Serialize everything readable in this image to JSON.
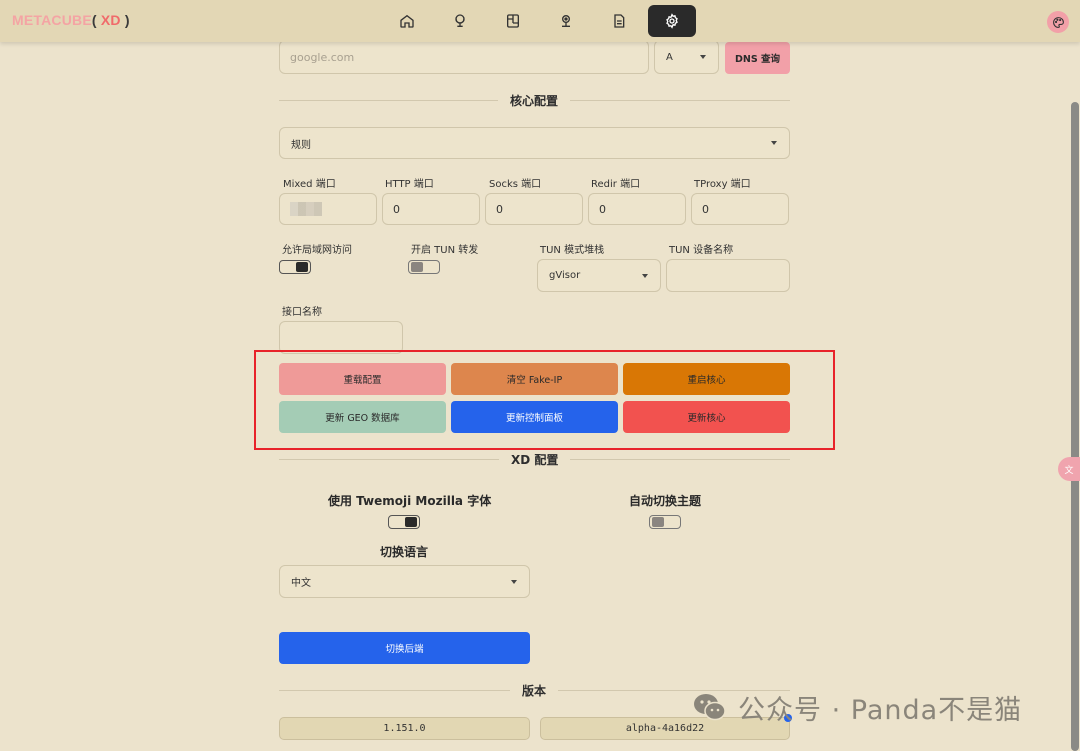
{
  "brand": {
    "part1": "METACUBE",
    "paren_open": "(",
    "part2": " XD ",
    "paren_close": ")"
  },
  "nav": {
    "icons": [
      "home-icon",
      "globe-icon",
      "connections-icon",
      "map-pin-icon",
      "document-icon",
      "gear-icon"
    ],
    "active": "gear-icon"
  },
  "dns": {
    "placeholder": "google.com",
    "type_value": "A",
    "query_button": "DNS 查询"
  },
  "core": {
    "title": "核心配置",
    "mode_value": "规则",
    "ports": [
      {
        "label": "Mixed 端口",
        "value": ""
      },
      {
        "label": "HTTP 端口",
        "value": "0"
      },
      {
        "label": "Socks 端口",
        "value": "0"
      },
      {
        "label": "Redir 端口",
        "value": "0"
      },
      {
        "label": "TProxy 端口",
        "value": "0"
      }
    ],
    "allow_lan_label": "允许局域网访问",
    "tun_label": "开启 TUN 转发",
    "tun_stack_label": "TUN 模式堆栈",
    "tun_stack_value": "gVisor",
    "tun_device_label": "TUN 设备名称",
    "tun_device_value": "",
    "interface_label": "接口名称",
    "interface_value": "",
    "actions": {
      "reload": "重载配置",
      "flush_fakeip": "清空 Fake-IP",
      "restart_core": "重启核心",
      "update_geo": "更新 GEO 数据库",
      "update_ui": "更新控制面板",
      "update_core": "更新核心"
    }
  },
  "xd": {
    "title": "XD 配置",
    "twemoji_label": "使用 Twemoji Mozilla 字体",
    "auto_theme_label": "自动切换主题",
    "language_label": "切换语言",
    "language_value": "中文",
    "switch_backend": "切换后端"
  },
  "version": {
    "title": "版本",
    "core_version": "1.151.0",
    "ui_version": "alpha-4a16d22"
  },
  "watermark": "公众号 · Panda不是猫",
  "colors": {
    "background": "#ece3cc",
    "navbar": "#e3d7b5",
    "reload_btn": "#ef9a98",
    "flush_btn": "#dd864d",
    "restart_btn": "#d97705",
    "geo_btn": "#a4ccb5",
    "ui_btn": "#2563eb",
    "core_btn": "#f2524f",
    "dns_btn": "#f2a0a8",
    "highlight": "#e8232a"
  }
}
